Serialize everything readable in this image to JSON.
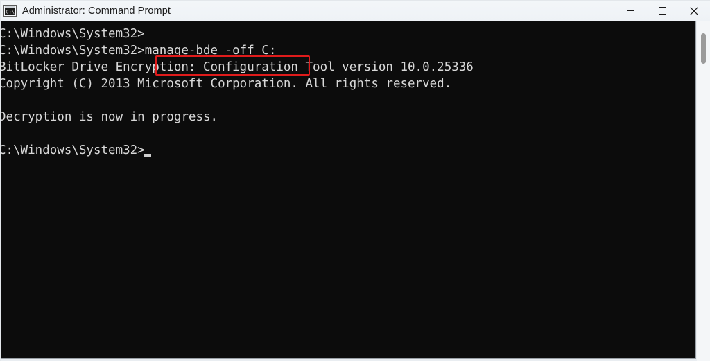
{
  "window": {
    "title": "Administrator: Command Prompt",
    "icon": "console-icon",
    "controls": {
      "minimize": "Minimize",
      "maximize": "Maximize",
      "close": "Close"
    }
  },
  "terminal": {
    "background_color": "#0c0c0c",
    "text_color": "#d8d8d8",
    "lines": [
      "C:\\Windows\\System32>",
      "C:\\Windows\\System32>manage-bde -off C:",
      "BitLocker Drive Encryption: Configuration Tool version 10.0.25336",
      "Copyright (C) 2013 Microsoft Corporation. All rights reserved.",
      "",
      "Decryption is now in progress.",
      "",
      "C:\\Windows\\System32>"
    ],
    "prompt": "C:\\Windows\\System32>",
    "command": "manage-bde -off C:",
    "cursor": "block-underscore"
  },
  "annotation": {
    "type": "highlight-rectangle",
    "color": "#e01b1b",
    "target_text": "manage-bde -off C:"
  },
  "scrollbar": {
    "orientation": "vertical",
    "thumb_color": "#9b9b9b",
    "track_color": "#f4f6f8"
  }
}
